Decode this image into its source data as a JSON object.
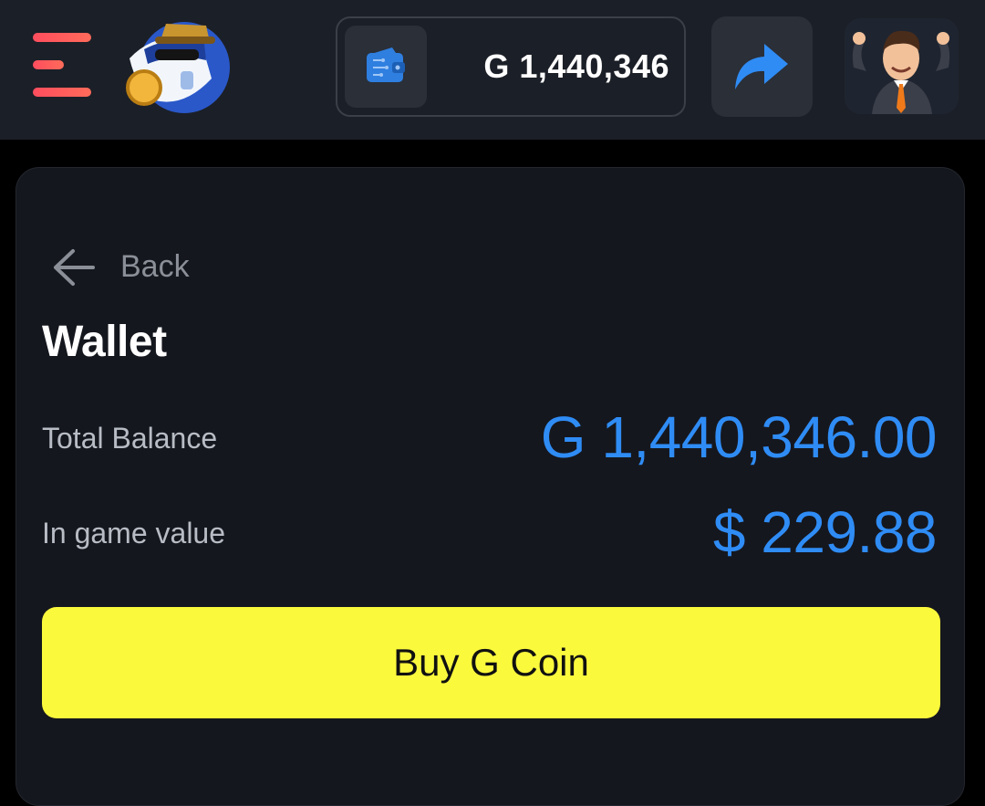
{
  "header": {
    "balance": "G 1,440,346"
  },
  "wallet": {
    "back_label": "Back",
    "title": "Wallet",
    "total_balance_label": "Total Balance",
    "total_balance_value": "G 1,440,346.00",
    "in_game_label": "In game value",
    "in_game_value": "$ 229.88",
    "buy_button_label": "Buy G Coin"
  },
  "colors": {
    "topbar_bg": "#1b1f27",
    "card_bg": "#15171e",
    "accent_blue": "#2f8cf5",
    "buy_button": "#fbf93c",
    "menu_gradient": "#ff4d5e"
  },
  "icons": {
    "menu": "hamburger-menu-icon",
    "logo": "shark-mascot-logo",
    "wallet": "wallet-icon",
    "share": "share-arrow-icon",
    "avatar": "businessman-avatar",
    "back": "arrow-left-icon"
  }
}
